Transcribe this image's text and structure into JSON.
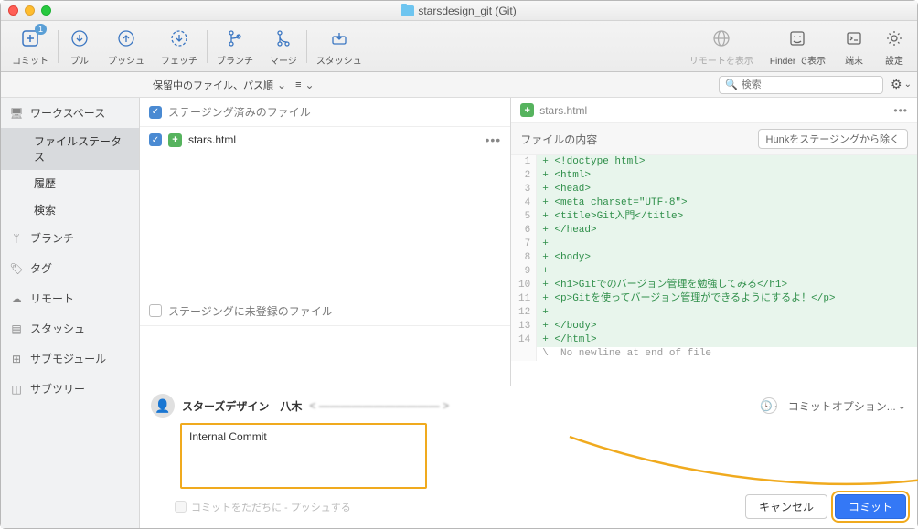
{
  "window": {
    "title": "starsdesign_git (Git)"
  },
  "toolbar": {
    "commit": "コミット",
    "commit_badge": "1",
    "pull": "プル",
    "push": "プッシュ",
    "fetch": "フェッチ",
    "branch": "ブランチ",
    "merge": "マージ",
    "stash": "スタッシュ",
    "remote_show": "リモートを表示",
    "finder": "Finder で表示",
    "terminal": "端末",
    "settings": "設定"
  },
  "filterbar": {
    "sort": "保留中のファイル、パス順",
    "view_icon": "≡",
    "search_placeholder": "検索"
  },
  "sidebar": {
    "workspace": "ワークスペース",
    "file_status": "ファイルステータス",
    "history": "履歴",
    "search": "検索",
    "branches": "ブランチ",
    "tags": "タグ",
    "remotes": "リモート",
    "stashes": "スタッシュ",
    "submodules": "サブモジュール",
    "subtrees": "サブツリー"
  },
  "staged": {
    "header": "ステージング済みのファイル",
    "files": [
      {
        "name": "stars.html",
        "status": "+"
      }
    ]
  },
  "unstaged": {
    "header": "ステージングに未登録のファイル"
  },
  "diff": {
    "filename": "stars.html",
    "section": "ファイルの内容",
    "unstage_btn": "Hunkをステージングから除く",
    "lines": [
      {
        "n": "1",
        "t": "+ <!doctype html>",
        "k": "add"
      },
      {
        "n": "2",
        "t": "+ <html>",
        "k": "add"
      },
      {
        "n": "3",
        "t": "+ <head>",
        "k": "add"
      },
      {
        "n": "4",
        "t": "+ <meta charset=\"UTF-8\">",
        "k": "add"
      },
      {
        "n": "5",
        "t": "+ <title>Git入門</title>",
        "k": "add"
      },
      {
        "n": "6",
        "t": "+ </head>",
        "k": "add"
      },
      {
        "n": "7",
        "t": "+ ",
        "k": "add"
      },
      {
        "n": "8",
        "t": "+ <body>",
        "k": "add"
      },
      {
        "n": "9",
        "t": "+ ",
        "k": "add"
      },
      {
        "n": "10",
        "t": "+ <h1>Gitでのバージョン管理を勉強してみる</h1>",
        "k": "add"
      },
      {
        "n": "11",
        "t": "+ <p>Gitを使ってバージョン管理ができるようにするよ！</p>",
        "k": "add"
      },
      {
        "n": "12",
        "t": "+ ",
        "k": "add"
      },
      {
        "n": "13",
        "t": "+ </body>",
        "k": "add"
      },
      {
        "n": "14",
        "t": "+ </html>",
        "k": "add"
      },
      {
        "n": "",
        "t": "\\  No newline at end of file",
        "k": "meta"
      }
    ]
  },
  "commit": {
    "author_name": "スターズデザイン　八木",
    "author_email_masked": "< ——————————— >",
    "options_label": "コミットオプション...",
    "message": "Internal Commit",
    "push_immediately": "コミットをただちに - プッシュする",
    "cancel": "キャンセル",
    "submit": "コミット"
  }
}
